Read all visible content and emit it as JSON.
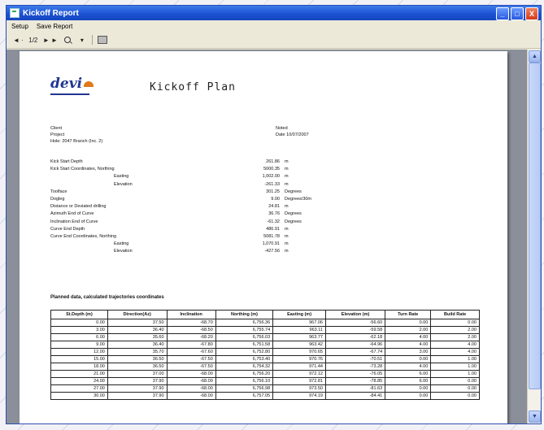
{
  "window": {
    "title": "Kickoff Report",
    "buttons": [
      "_",
      "□",
      "X"
    ]
  },
  "menu": {
    "items": [
      "Setup",
      "Save Report"
    ]
  },
  "toolbar": {
    "prev": "◄ ·",
    "page": "1/2",
    "next": "► ►",
    "zoom_arrow": "▾"
  },
  "report": {
    "logo": "devi",
    "title": "Kickoff Plan",
    "header": {
      "client": "Client",
      "project": "Project",
      "hole": "Hole: 2047 Branch (Inc. 2)",
      "notes": "Noted",
      "date": "Date 10/07/2007"
    },
    "params": [
      {
        "label": "Kick Start Depth",
        "sub": "",
        "value": "261.86",
        "unit": "m"
      },
      {
        "label": "Kick Start Coordinates, Northing",
        "sub": "",
        "value": "5000.35",
        "unit": "m"
      },
      {
        "label": "",
        "sub": "Easting",
        "value": "1,002.00",
        "unit": "m"
      },
      {
        "label": "",
        "sub": "Elevation",
        "value": "-261.33",
        "unit": "m"
      },
      {
        "label": "Toolface",
        "sub": "",
        "value": "301.25",
        "unit": "Degrees"
      },
      {
        "label": "Dogleg",
        "sub": "",
        "value": "9.00",
        "unit": "Degrees/30m"
      },
      {
        "label": "Distance or Deviated drilling",
        "sub": "",
        "value": "24.81",
        "unit": "m"
      },
      {
        "label": "Azimuth End of Curve",
        "sub": "",
        "value": "36.76",
        "unit": "Degrees"
      },
      {
        "label": "Inclination End of Curve",
        "sub": "",
        "value": "-61.32",
        "unit": "Degrees"
      },
      {
        "label": "Curve End Depth",
        "sub": "",
        "value": "486.91",
        "unit": "m"
      },
      {
        "label": "Curve End Coordinates, Northing",
        "sub": "",
        "value": "5081.78",
        "unit": "m"
      },
      {
        "label": "",
        "sub": "Easting",
        "value": "1,070.91",
        "unit": "m"
      },
      {
        "label": "",
        "sub": "Elevation",
        "value": "-427.56",
        "unit": "m"
      }
    ],
    "table_title": "Planned data, calculated trajectories coordinates",
    "columns": [
      "St.Depth (m)",
      "Direction(Az)",
      "Inclination",
      "Northing (m)",
      "Easting (m)",
      "Elevation (m)",
      "Turn Rate",
      "Build Rate"
    ],
    "rows": [
      [
        "0.00",
        "37.50",
        "-68.70",
        "6,756.36",
        "967.06",
        "-56.60",
        "0.00",
        "0.00"
      ],
      [
        "3.00",
        "36.40",
        "-68.50",
        "6,755.74",
        "963.11",
        "-59.58",
        "2.00",
        "2.00"
      ],
      [
        "6.00",
        "35.60",
        "-68.20",
        "6,756.03",
        "963.77",
        "-62.18",
        "4.00",
        "2.00"
      ],
      [
        "9.00",
        "36.40",
        "-67.80",
        "6,751.58",
        "963.42",
        "-64.96",
        "4.00",
        "4.00"
      ],
      [
        "12.00",
        "35.70",
        "-67.60",
        "6,752.80",
        "970.65",
        "-67.74",
        "3.00",
        "4.00"
      ],
      [
        "15.00",
        "36.50",
        "-67.50",
        "6,753.40",
        "970.76",
        "-70.51",
        "0.00",
        "1.00"
      ],
      [
        "18.00",
        "36.50",
        "-67.50",
        "6,754.32",
        "971.44",
        "-73.28",
        "4.00",
        "1.00"
      ],
      [
        "21.00",
        "37.00",
        "-68.00",
        "6,756.20",
        "972.12",
        "-76.05",
        "6.00",
        "1.00"
      ],
      [
        "24.00",
        "37.90",
        "-68.00",
        "6,756.10",
        "972.81",
        "-78.85",
        "6.00",
        "0.00"
      ],
      [
        "27.00",
        "37.90",
        "-68.00",
        "6,756.98",
        "973.50",
        "-81.63",
        "0.00",
        "0.00"
      ],
      [
        "30.00",
        "37.90",
        "-68.00",
        "6,757.05",
        "974.19",
        "-84.41",
        "0.00",
        "0.00"
      ]
    ]
  }
}
